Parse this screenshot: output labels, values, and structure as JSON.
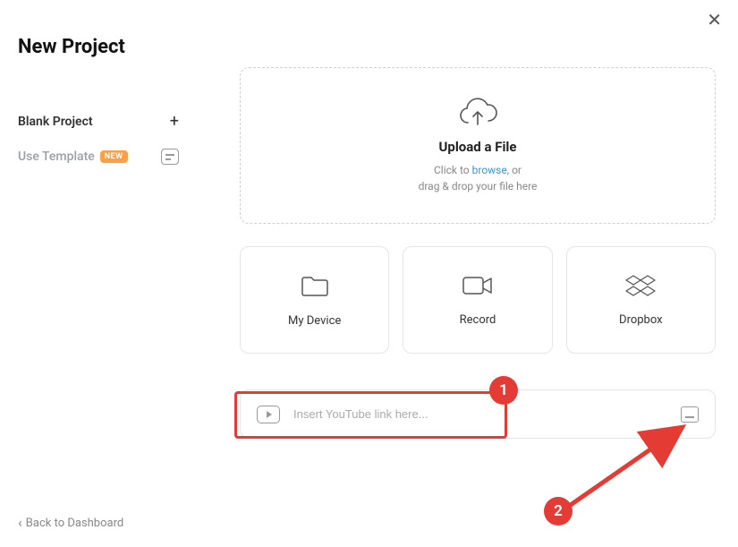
{
  "sidebar": {
    "title": "New Project",
    "blank_label": "Blank Project",
    "template_label": "Use Template",
    "new_badge": "NEW",
    "back_label": "Back to Dashboard"
  },
  "upload": {
    "title": "Upload a File",
    "click_to": "Click to ",
    "browse": "browse",
    "or": ", or",
    "drag_line": "drag & drop your file here"
  },
  "cards": {
    "device": "My Device",
    "record": "Record",
    "dropbox": "Dropbox"
  },
  "link_row": {
    "placeholder": "Insert YouTube link here..."
  },
  "annotations": {
    "one": "1",
    "two": "2"
  }
}
